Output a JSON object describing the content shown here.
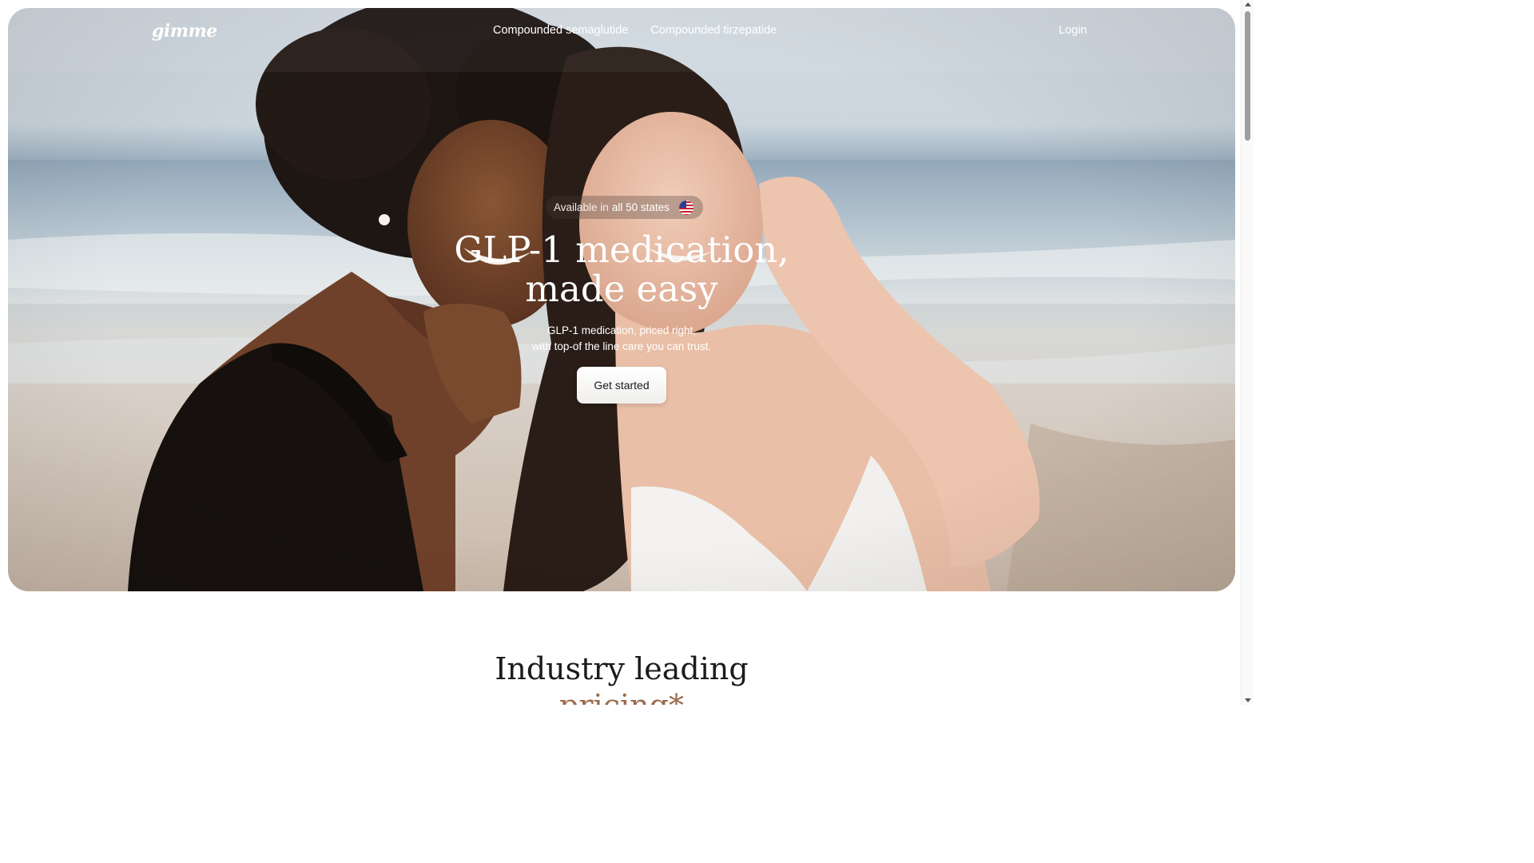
{
  "nav": {
    "logo": "gimme",
    "links": [
      "Compounded semaglutide",
      "Compounded tirzepatide"
    ],
    "login": "Login"
  },
  "hero": {
    "badge_prefix": "Available in",
    "badge_strong": "all 50 states",
    "badge_icon": "us-flag-icon",
    "title_line1": "GLP-1 medication,",
    "title_line2": "made easy",
    "subtitle_line1": "GLP-1 medication, priced right,",
    "subtitle_line2": "with top-of the line care you can trust.",
    "cta": "Get started"
  },
  "pricing": {
    "title_line1": "Industry leading",
    "title_line2": "pricing",
    "title_asterisk": "*"
  },
  "colors": {
    "accent": "#9b6a4c",
    "text_dark": "#1b1b1b",
    "hero_text": "#ffffff"
  }
}
